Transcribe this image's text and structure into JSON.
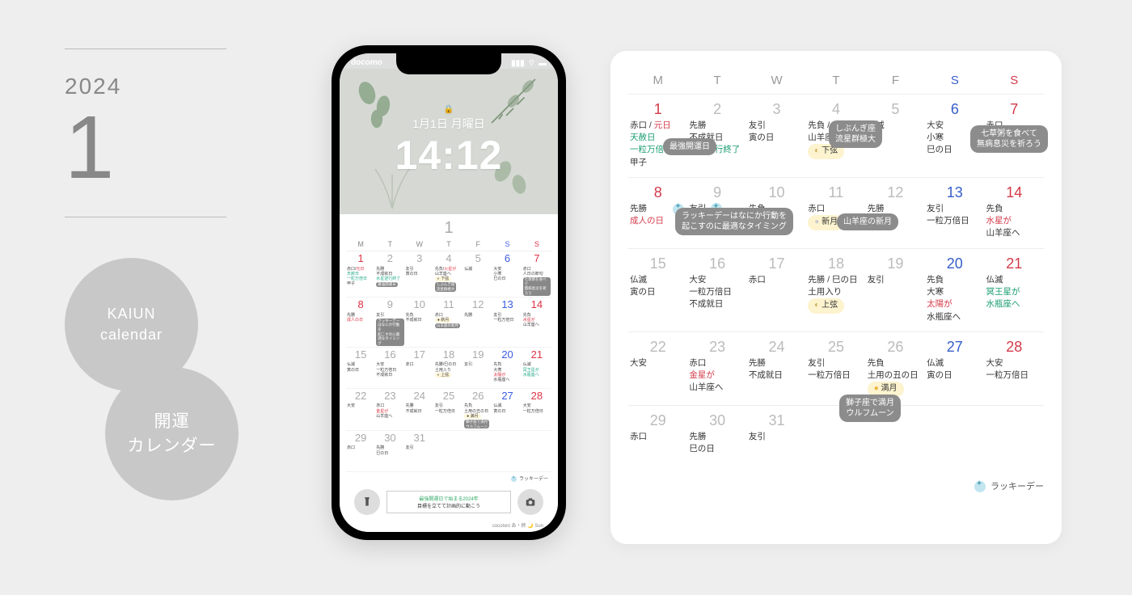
{
  "left": {
    "year": "2024",
    "month": "1",
    "circle1_line1": "KAIUN",
    "circle1_line2": "calendar",
    "circle2_line1": "開運",
    "circle2_line2": "カレンダー"
  },
  "phone": {
    "carrier": "docomo",
    "lock_date": "1月1日 月曜日",
    "lock_time": "14:12",
    "month_label": "1",
    "dow": [
      "M",
      "T",
      "W",
      "T",
      "F",
      "S",
      "S"
    ],
    "weeks": [
      [
        {
          "n": "1",
          "c": "red",
          "t": "赤口/<span class='txt-red'>元日</span><br><span class='txt-green'>天赦日<br>一粒万倍日</span><br>甲子"
        },
        {
          "n": "2",
          "t": "先勝<br>不成就日<br><span class='txt-green'>水星逆行終了</span><br><span class='ptag'>最強開運日</span>"
        },
        {
          "n": "3",
          "t": "友引<br>寅の日"
        },
        {
          "n": "4",
          "t": "先負/<span class='txt-red'>火星が</span><br>山羊座へ<br><span class='pmoon'>◐ 下弦</span> <span class='ptag'>しぶんぎ座<br>流星群極大</span>"
        },
        {
          "n": "5",
          "t": "仏滅"
        },
        {
          "n": "6",
          "c": "blue",
          "t": "大安<br>小寒<br>巳の日"
        },
        {
          "n": "7",
          "c": "red",
          "t": "赤口<br>人日の節句<br><span class='ptag'>七草粥を食べて<br>無病息災を祈ろう</span>"
        }
      ],
      [
        {
          "n": "8",
          "c": "red",
          "t": "先勝<br><span class='txt-red'>成人の日</span>"
        },
        {
          "n": "9",
          "t": "友引<br><span class='ptag'>ラッキーデーはなにか行動を<br>起こすのに最適なタイミング</span>",
          "lucky": true
        },
        {
          "n": "10",
          "t": "先負<br>不成就日"
        },
        {
          "n": "11",
          "t": "赤口<br><span class='pmoon'>● 新月</span> <span class='ptag'>山羊座の新月</span>"
        },
        {
          "n": "12",
          "t": "先勝"
        },
        {
          "n": "13",
          "c": "blue",
          "t": "友引<br>一粒万倍日"
        },
        {
          "n": "14",
          "c": "red",
          "t": "先負<br><span class='txt-red'>水星が</span><br>山羊座へ"
        }
      ],
      [
        {
          "n": "15",
          "t": "仏滅<br>寅の日"
        },
        {
          "n": "16",
          "t": "大安<br>一粒万倍日<br>不成就日"
        },
        {
          "n": "17",
          "t": "赤口"
        },
        {
          "n": "18",
          "t": "先勝/巳の日<br>土用入り<br><span class='pmoon'>◐ 上弦</span>"
        },
        {
          "n": "19",
          "t": "友引"
        },
        {
          "n": "20",
          "c": "blue",
          "t": "先負<br>大寒<br><span class='txt-red'>太陽が</span><br>水瓶座へ"
        },
        {
          "n": "21",
          "c": "red",
          "t": "仏滅<br><span class='txt-green'>冥王星が<br>水瓶座へ</span>"
        }
      ],
      [
        {
          "n": "22",
          "t": "大安"
        },
        {
          "n": "23",
          "t": "赤口<br><span class='txt-red'>金星が</span><br>山羊座へ"
        },
        {
          "n": "24",
          "t": "先勝<br>不成就日"
        },
        {
          "n": "25",
          "t": "友引<br>一粒万倍日"
        },
        {
          "n": "26",
          "t": "先負<br>土用の丑の日<br><span class='pmoon'>● 満月</span><br><span class='ptag'>獅子座で満月<br>ウルフムーン</span>"
        },
        {
          "n": "27",
          "c": "blue",
          "t": "仏滅<br>寅の日"
        },
        {
          "n": "28",
          "c": "red",
          "t": "大安<br>一粒万倍日"
        }
      ],
      [
        {
          "n": "29",
          "t": "赤口"
        },
        {
          "n": "30",
          "t": "先勝<br>巳の日"
        },
        {
          "n": "31",
          "t": "友引"
        },
        {
          "n": "",
          "t": ""
        },
        {
          "n": "",
          "t": ""
        },
        {
          "n": "",
          "t": ""
        },
        {
          "n": "",
          "t": ""
        }
      ]
    ],
    "legend": "ラッキーデー",
    "msg_line1": "最強開運日で始まる2024年",
    "msg_line2": "目標を立てて計画的に動こう",
    "credit": "cocoloni あ・終 🌙 Sun"
  },
  "cal": {
    "dow": [
      "M",
      "T",
      "W",
      "T",
      "F",
      "S",
      "S"
    ],
    "weeks": [
      [
        {
          "n": "1",
          "c": "red",
          "lines": "赤口 / <span class='r'>元日</span><br><span class='g'>天赦日</span><br><span class='g'>一粒万倍日</span><br>甲子"
        },
        {
          "n": "2",
          "lines": "先勝<br>不成就日<br><span class='g'>水星逆行終了</span>"
        },
        {
          "n": "3",
          "lines": "友引<br>寅の日"
        },
        {
          "n": "4",
          "lines": "先負 / <span class='r'>火星が</span><br>山羊座へ<br><span class='moon'>下弦</span>"
        },
        {
          "n": "5",
          "lines": "仏滅"
        },
        {
          "n": "6",
          "c": "blue",
          "lines": "大安<br>小寒<br>巳の日"
        },
        {
          "n": "7",
          "c": "red",
          "lines": "赤口<br>人日の節句"
        }
      ],
      [
        {
          "n": "8",
          "c": "red",
          "lines": "先勝<br><span class='r'>成人の日</span>",
          "lucky": true
        },
        {
          "n": "9",
          "lines": "友引 &nbsp;<span class='lucky'></span>"
        },
        {
          "n": "10",
          "lines": "先負<br>不成就日"
        },
        {
          "n": "11",
          "lines": "赤口<br><span class='moon new'>新月</span>"
        },
        {
          "n": "12",
          "lines": "先勝"
        },
        {
          "n": "13",
          "c": "blue",
          "lines": "友引<br>一粒万倍日"
        },
        {
          "n": "14",
          "c": "red",
          "lines": "先負<br><span class='r'>水星が</span><br>山羊座へ"
        }
      ],
      [
        {
          "n": "15",
          "lines": "仏滅<br>寅の日"
        },
        {
          "n": "16",
          "lines": "大安<br>一粒万倍日<br>不成就日"
        },
        {
          "n": "17",
          "lines": "赤口"
        },
        {
          "n": "18",
          "lines": "先勝 / 巳の日<br>土用入り<br><span class='moon'>上弦</span>"
        },
        {
          "n": "19",
          "lines": "友引"
        },
        {
          "n": "20",
          "c": "blue",
          "lines": "先負<br>大寒<br><span class='r'>太陽が</span><br>水瓶座へ"
        },
        {
          "n": "21",
          "c": "red",
          "lines": "仏滅<br><span class='g'>冥王星が</span><br><span class='g'>水瓶座へ</span>"
        }
      ],
      [
        {
          "n": "22",
          "lines": "大安"
        },
        {
          "n": "23",
          "lines": "赤口<br><span class='r'>金星が</span><br>山羊座へ"
        },
        {
          "n": "24",
          "lines": "先勝<br>不成就日"
        },
        {
          "n": "25",
          "lines": "友引<br>一粒万倍日"
        },
        {
          "n": "26",
          "lines": "先負<br>土用の丑の日<br><span class='moon full'>満月</span>"
        },
        {
          "n": "27",
          "c": "blue",
          "lines": "仏滅<br>寅の日"
        },
        {
          "n": "28",
          "c": "red",
          "lines": "大安<br>一粒万倍日"
        }
      ],
      [
        {
          "n": "29",
          "lines": "赤口"
        },
        {
          "n": "30",
          "lines": "先勝<br>巳の日"
        },
        {
          "n": "31",
          "lines": "友引"
        },
        {
          "n": ""
        },
        {
          "n": ""
        },
        {
          "n": ""
        },
        {
          "n": ""
        }
      ]
    ],
    "legend": "ラッキーデー",
    "callouts": {
      "saikyo": "最強開運日",
      "shibungi": "しぶんぎ座<br>流星群極大",
      "nanakusa": "七草粥を食べて<br>無病息災を祈ろう",
      "luckyday": "ラッキーデーはなにか行動を<br>起こすのに最適なタイミング",
      "yagiza": "山羊座の新月",
      "shishi": "獅子座で満月<br>ウルフムーン"
    }
  }
}
